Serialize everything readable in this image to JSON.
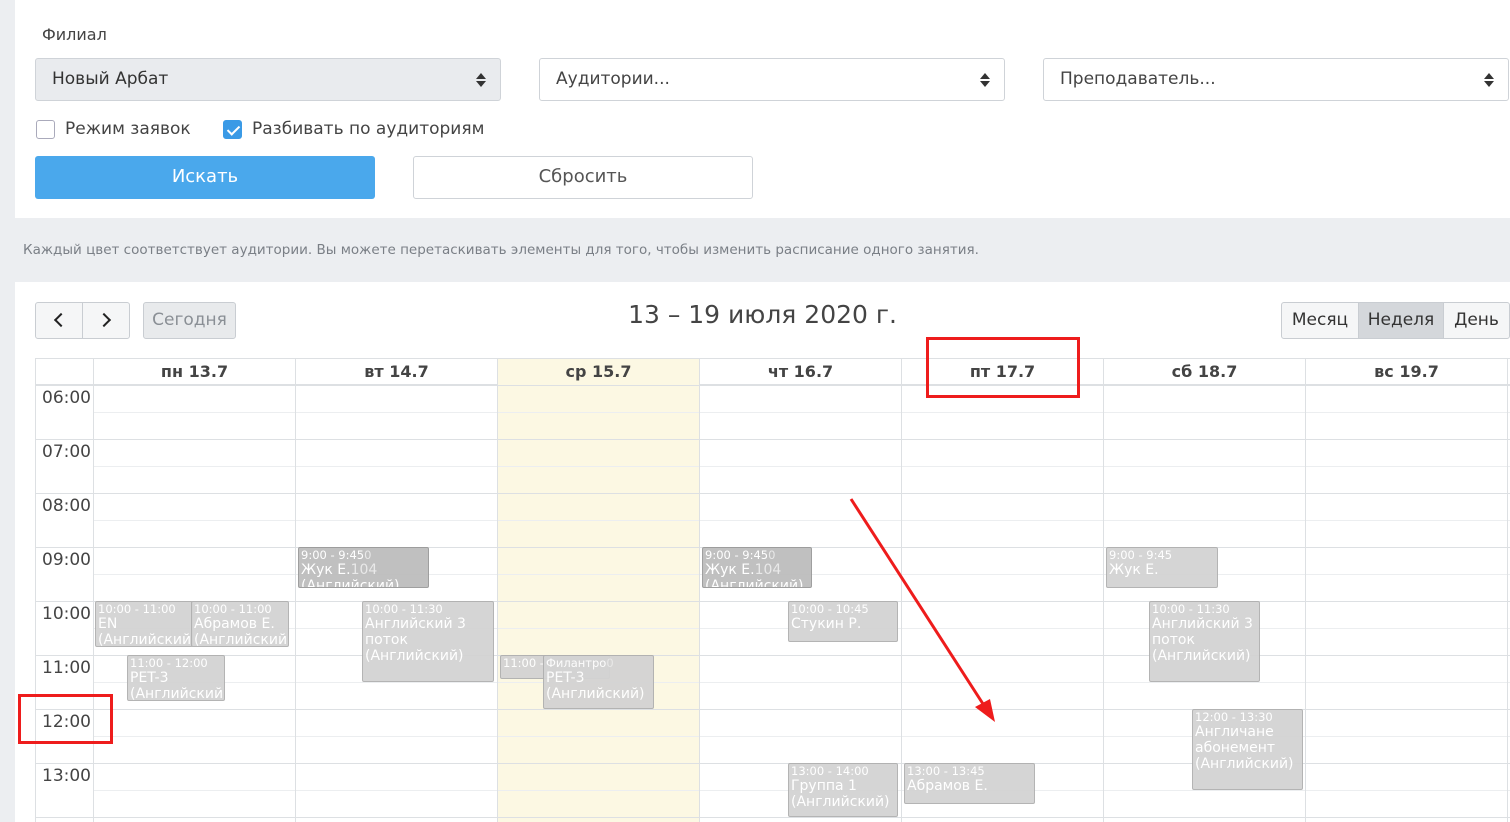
{
  "filter": {
    "branch_label": "Филиал",
    "branch_value": "Новый Арбат",
    "rooms_placeholder": "Аудитории...",
    "teacher_placeholder": "Преподаватель...",
    "requests_mode_label": "Режим заявок",
    "requests_mode_checked": false,
    "split_by_rooms_label": "Разбивать по аудиториям",
    "split_by_rooms_checked": true,
    "search_label": "Искать",
    "reset_label": "Сбросить"
  },
  "hint": "Каждый цвет соответствует аудитории. Вы можете перетаскивать элементы для того, чтобы изменить расписание одного занятия.",
  "calendar": {
    "today_label": "Сегодня",
    "title": "13 – 19 июля 2020 г.",
    "views": {
      "month": "Месяц",
      "week": "Неделя",
      "day": "День",
      "active": "week"
    },
    "days": [
      {
        "label": "пн 13.7"
      },
      {
        "label": "вт 14.7"
      },
      {
        "label": "ср 15.7",
        "today": true
      },
      {
        "label": "чт 16.7"
      },
      {
        "label": "пт 17.7"
      },
      {
        "label": "сб 18.7"
      },
      {
        "label": "вс 19.7"
      }
    ],
    "times": [
      "06:00",
      "07:00",
      "08:00",
      "09:00",
      "10:00",
      "11:00",
      "12:00",
      "13:00"
    ],
    "events": [
      {
        "day": 0,
        "time": "10:00 - 11:00",
        "title": "EN",
        "subject": "(Английский",
        "sub": 0
      },
      {
        "day": 0,
        "time": "10:00 - 11:00",
        "title": "Абрамов Е.",
        "subject": "(Английский)",
        "sub": 1
      },
      {
        "day": 0,
        "time": "11:00 - 12:00",
        "title": "PET-3",
        "subject": "(Английский)",
        "sub": 2
      },
      {
        "day": 1,
        "time": "9:00 - 9:45",
        "room": "0",
        "title": "Жук Е.",
        "room2": "104",
        "subject": "(Английский)",
        "dark": true
      },
      {
        "day": 1,
        "time": "10:00 - 11:30",
        "title": "Английский 3",
        "title2": "поток",
        "subject": "(Английский)"
      },
      {
        "day": 2,
        "time": "11:00 -",
        "sub": 3
      },
      {
        "day": 2,
        "time": "Филантро",
        "time2": "0",
        "title": "PET-3",
        "subject": "(Английский)",
        "sub": 4
      },
      {
        "day": 3,
        "time": "9:00 - 9:45",
        "room": "0",
        "title": "Жук Е.",
        "room2": "104",
        "subject": "(Английский)",
        "dark": true
      },
      {
        "day": 3,
        "time": "10:00 - 10:45",
        "title": "Стукин Р."
      },
      {
        "day": 3,
        "time": "13:00 - 14:00",
        "title": "Группа 1",
        "subject": "(Английский)"
      },
      {
        "day": 4,
        "time": "13:00 - 13:45",
        "title": "Абрамов Е."
      },
      {
        "day": 5,
        "time": "9:00 - 9:45",
        "title": "Жук Е."
      },
      {
        "day": 5,
        "time": "10:00 - 11:30",
        "title": "Английский 3",
        "title2": "поток",
        "subject": "(Английский)"
      },
      {
        "day": 5,
        "time": "12:00 - 13:30",
        "title": "Англичане",
        "title2": "абонемент",
        "subject": "(Английский)"
      }
    ]
  },
  "annotations": {
    "color": "#ee1c1c"
  }
}
